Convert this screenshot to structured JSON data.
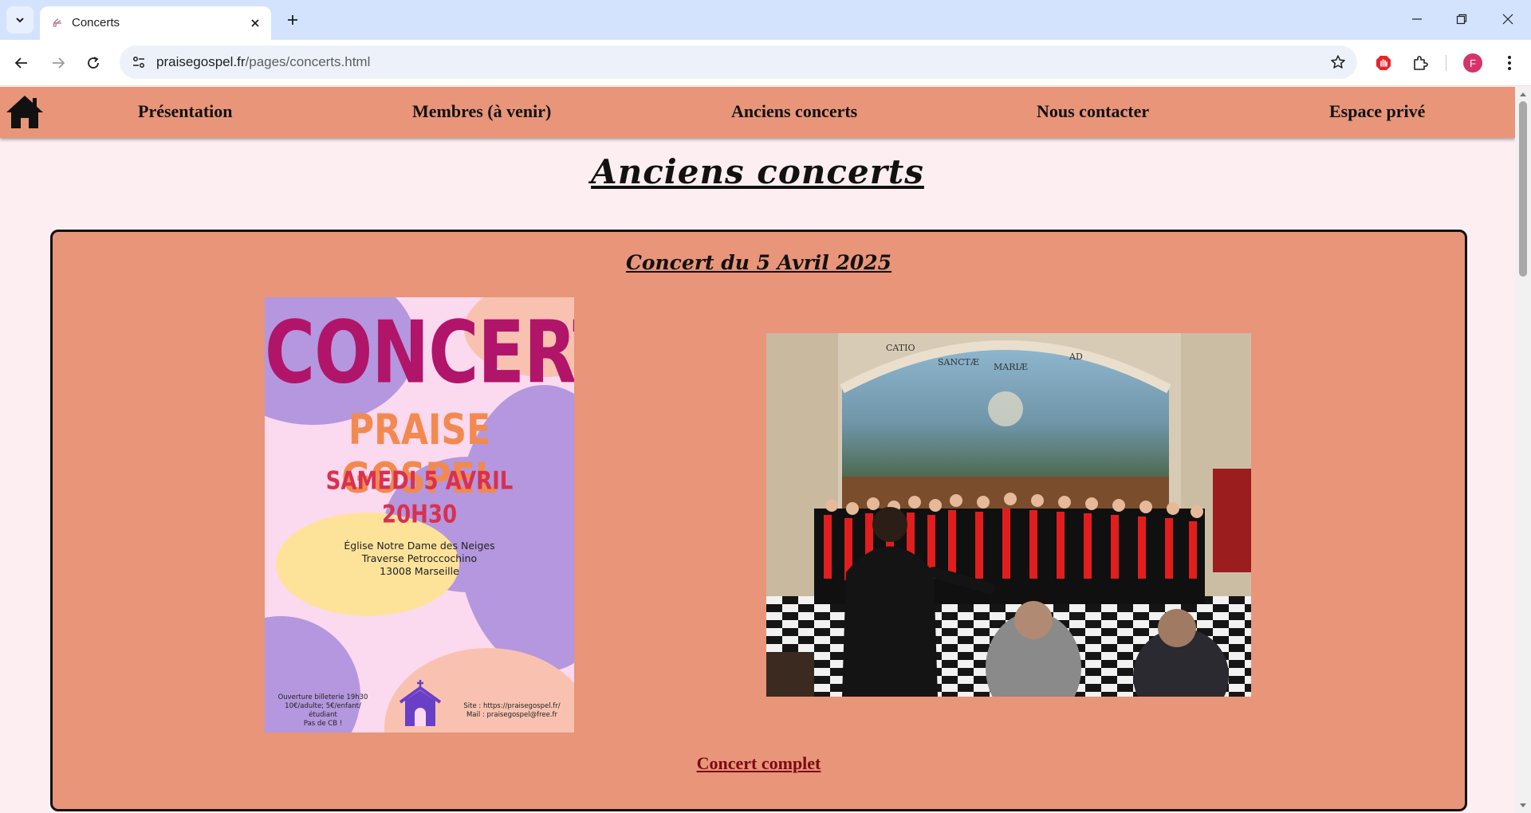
{
  "browser": {
    "tab_title": "Concerts",
    "url_host": "praisegospel.fr",
    "url_path": "/pages/concerts.html",
    "profile_initial": "F"
  },
  "site_nav": {
    "items": [
      {
        "label": "Présentation"
      },
      {
        "label": "Membres (à venir)"
      },
      {
        "label": "Anciens concerts"
      },
      {
        "label": "Nous contacter"
      },
      {
        "label": "Espace privé"
      }
    ]
  },
  "page": {
    "title": "Anciens concerts",
    "concert": {
      "title": "Concert du 5 Avril 2025",
      "link_label": "Concert complet",
      "poster": {
        "line1": "CONCERT",
        "line2": "PRAISE GOSPEL",
        "line3": "SAMEDI 5 AVRIL",
        "line4": "20H30",
        "address_1": "Église Notre Dame des Neiges",
        "address_2": "Traverse Petroccochino",
        "address_3": "13008 Marseille",
        "footer_left_1": "Ouverture billeterie 19h30",
        "footer_left_2": "10€/adulte; 5€/enfant/étudiant",
        "footer_left_3": "Pas de CB !",
        "footer_right_1": "Site : https://praisegospel.fr/",
        "footer_right_2": "Mail : praisegospel@free.fr"
      },
      "photo": {
        "dome_text_1": "SANCTÆ",
        "dome_text_2": "MARIÆ",
        "dome_text_3": "CATIO",
        "dome_text_4": "AD"
      }
    }
  },
  "colors": {
    "nav_bg": "#e8957a",
    "page_bg": "#fdeef2",
    "link": "#7a0a12"
  }
}
